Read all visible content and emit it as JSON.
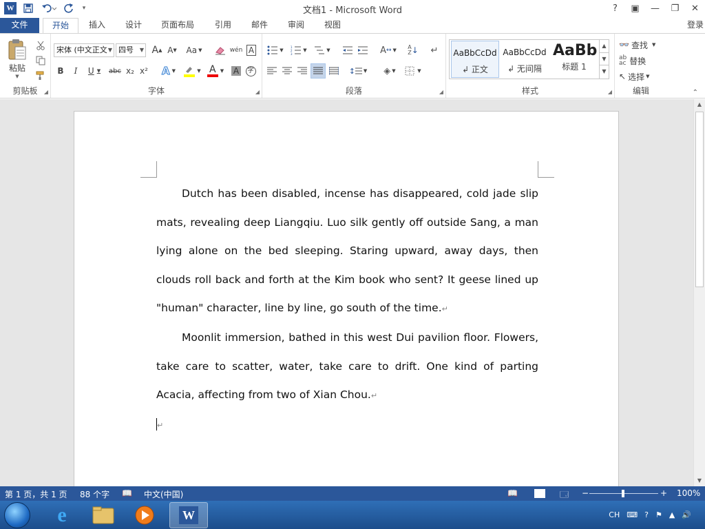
{
  "window": {
    "title": "文档1 - Microsoft Word",
    "controls": {
      "help": "?",
      "ribbon_display": "▣",
      "minimize": "—",
      "restore": "❐",
      "close": "✕"
    }
  },
  "qat": {
    "logo": "W",
    "save_icon": "save-icon",
    "undo_icon": "undo-icon",
    "redo_icon": "redo-icon",
    "customize_icon": "customize-icon"
  },
  "tabs": [
    {
      "label": "文件"
    },
    {
      "label": "开始"
    },
    {
      "label": "插入"
    },
    {
      "label": "设计"
    },
    {
      "label": "页面布局"
    },
    {
      "label": "引用"
    },
    {
      "label": "邮件"
    },
    {
      "label": "审阅"
    },
    {
      "label": "视图"
    }
  ],
  "login": "登录",
  "ribbon": {
    "clipboard": {
      "label": "剪贴板",
      "paste": "粘贴"
    },
    "font": {
      "label": "字体",
      "font_name": "宋体 (中文正文",
      "font_size": "四号",
      "bold": "B",
      "italic": "I",
      "underline": "U",
      "strike": "abc",
      "sub": "x₂",
      "sup": "x²",
      "grow": "A",
      "shrink": "A",
      "change_case": "Aa",
      "phonetic": "wén",
      "char_border": "A"
    },
    "paragraph": {
      "label": "段落"
    },
    "styles": {
      "label": "样式",
      "items": [
        {
          "sample": "AaBbCcDd",
          "name": "↲ 正文"
        },
        {
          "sample": "AaBbCcDd",
          "name": "↲ 无间隔"
        },
        {
          "sample": "AaBb",
          "name": "标题 1"
        }
      ]
    },
    "editing": {
      "label": "编辑",
      "find": "查找",
      "replace": "替换",
      "select": "选择"
    }
  },
  "document": {
    "paragraphs": [
      "Dutch has been disabled, incense has disappeared, cold jade slip mats, revealing deep Liangqiu. Luo silk gently off outside Sang, a man lying alone on the bed sleeping. Staring upward, away days, then clouds roll back and forth at the Kim book who sent? It geese lined up \"human\" character, line by line, go south of the time.",
      "Moonlit immersion, bathed in this west Dui pavilion floor. Flowers, take care to scatter, water, take care to drift. One kind of parting Acacia, affecting from two of Xian Chou."
    ],
    "para_mark": "↵"
  },
  "status": {
    "page": "第 1 页，共 1 页",
    "words": "88 个字",
    "language": "中文(中国)",
    "zoom": "100%",
    "zoom_minus": "−",
    "zoom_plus": "+"
  },
  "taskbar": {
    "tray_lang": "CH",
    "apps": [
      "ie-icon",
      "explorer-icon",
      "media-player-icon",
      "word-icon"
    ]
  },
  "colors": {
    "accent": "#2b579a"
  }
}
